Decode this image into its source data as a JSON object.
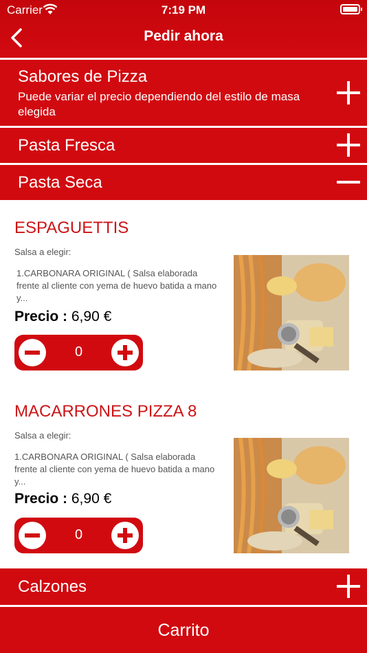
{
  "status": {
    "carrier": "Carrier",
    "time": "7:19 PM"
  },
  "nav": {
    "title": "Pedir ahora"
  },
  "sections": [
    {
      "title": "Sabores de Pizza",
      "subtitle": "Puede variar el precio dependiendo del estilo de masa elegida",
      "expanded": false
    },
    {
      "title": "Pasta Fresca",
      "expanded": false
    },
    {
      "title": "Pasta Seca",
      "expanded": true
    },
    {
      "title": "Calzones",
      "expanded": false
    }
  ],
  "products": [
    {
      "name": "ESPAGUETTIS",
      "label": "Salsa a elegir:",
      "description": "1.CARBONARA ORIGINAL ( Salsa elaborada frente al cliente con yema de huevo batida a mano y...",
      "price_label": "Precio :",
      "price": "6,90 €",
      "quantity": "0"
    },
    {
      "name": "MACARRONES PIZZA 8",
      "label": "Salsa a elegir:",
      "description": "1.CARBONARA ORIGINAL ( Salsa elaborada frente al cliente con yema de huevo batida a mano y...",
      "price_label": "Precio :",
      "price": "6,90 €",
      "quantity": "0"
    }
  ],
  "cart": {
    "label": "Carrito"
  },
  "colors": {
    "accent": "#d10a10",
    "product_title": "#cc1416"
  },
  "icons": {
    "back": "chevron-left-icon",
    "expand": "plus-icon",
    "collapse": "minus-icon"
  }
}
